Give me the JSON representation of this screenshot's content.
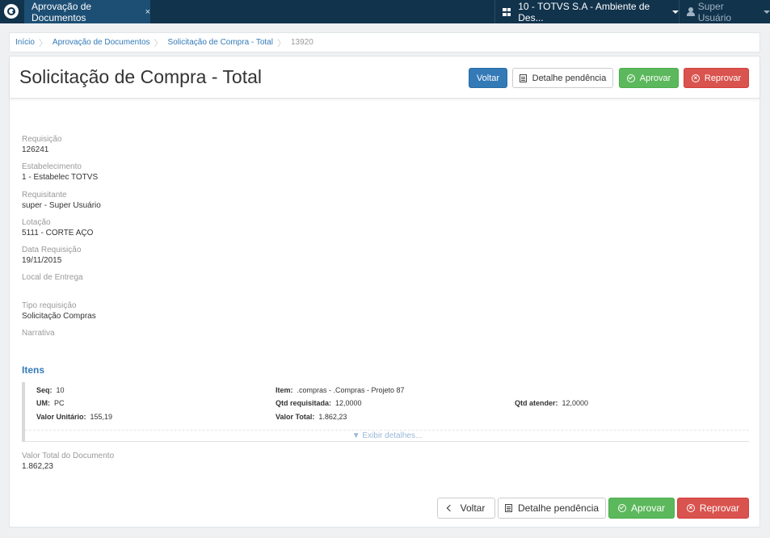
{
  "topbar": {
    "app_tab_label": "Aprovação de Documentos",
    "app_tab_close": "×",
    "company": "10 - TOTVS S.A - Ambiente de Des...",
    "user": "Super Usuário"
  },
  "breadcrumb": [
    "Início",
    "Aprovação de Documentos",
    "Solicitação de Compra - Total",
    "13920"
  ],
  "page": {
    "title": "Solicitação de Compra - Total",
    "buttons": {
      "voltar": "Voltar",
      "detalhe": "Detalhe pendência",
      "aprovar": "Aprovar",
      "reprovar": "Reprovar"
    }
  },
  "fields": [
    {
      "label": "Requisição",
      "value": "126241"
    },
    {
      "label": "Estabelecimento",
      "value": "1 - Estabelec TOTVS"
    },
    {
      "label": "Requisitante",
      "value": "super - Super Usuário"
    },
    {
      "label": "Lotação",
      "value": "5111 - CORTE AÇO"
    },
    {
      "label": "Data Requisição",
      "value": "19/11/2015"
    },
    {
      "label": "Local de Entrega",
      "value": ""
    },
    {
      "label": "Tipo requisição",
      "value": "Solicitação Compras"
    },
    {
      "label": "Narrativa",
      "value": ""
    }
  ],
  "items": {
    "title": "Itens",
    "row": {
      "seq_label": "Seq:",
      "seq": "10",
      "item_label": "Item:",
      "item": ".compras - .Compras - Projeto 87",
      "um_label": "UM:",
      "um": "PC",
      "qtd_req_label": "Qtd requisitada:",
      "qtd_req": "12,0000",
      "qtd_atender_label": "Qtd atender:",
      "qtd_atender": "12,0000",
      "valor_unit_label": "Valor Unitário:",
      "valor_unit": "155,19",
      "valor_total_label": "Valor Total:",
      "valor_total": "1.862,23"
    },
    "show_details": "▼ Exibir detalhes..."
  },
  "total": {
    "label": "Valor Total do Documento",
    "value": "1.862,23"
  },
  "colors": {
    "topbar": "#11334c",
    "active_tab": "#1d4f74",
    "primary": "#337ab7",
    "success": "#5cb85c",
    "danger": "#d9534f"
  }
}
